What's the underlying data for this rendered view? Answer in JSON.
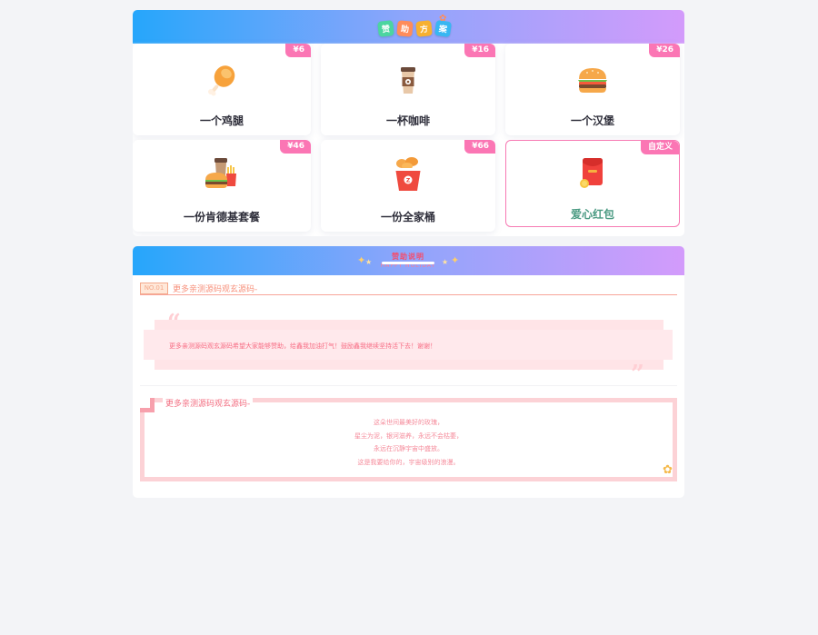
{
  "sponsor_header": {
    "tiles": [
      "赞",
      "助",
      "方",
      "案"
    ]
  },
  "options": [
    {
      "label": "一个鸡腿",
      "price": "¥6",
      "icon": "chicken-leg-icon"
    },
    {
      "label": "一杯咖啡",
      "price": "¥16",
      "icon": "coffee-cup-icon"
    },
    {
      "label": "一个汉堡",
      "price": "¥26",
      "icon": "burger-icon"
    },
    {
      "label": "一份肯德基套餐",
      "price": "¥46",
      "icon": "kfc-meal-icon"
    },
    {
      "label": "一份全家桶",
      "price": "¥66",
      "icon": "chicken-bucket-icon"
    },
    {
      "label": "爱心红包",
      "price": "自定义",
      "icon": "red-envelope-icon"
    }
  ],
  "description": {
    "title": "赞助说明",
    "subtitle": "HAPPY HOLIDAY",
    "no_badge": "NO.01",
    "no_text": "更多亲测源码观玄源码-",
    "quote": "更多亲测源码观玄源码希望大家能够赞助，给鑫我加油打气！鼓励鑫我继续坚持活下去！谢谢！",
    "poem_title": "更多亲测源码观玄源码-",
    "poem": [
      "这朵世间最美好的玫瑰，",
      "星尘为泥，银河滋养，永远不会枯萎，",
      "永远在沉静宇宙中盛放。",
      "这是我要给你的，宇宙级别的浪漫。"
    ]
  },
  "colors": {
    "accent_pink": "#fb76b4",
    "header_gradient": [
      "#26a6fb",
      "#8fa5fb",
      "#d39bfb"
    ],
    "label_green": "#4a9a82"
  }
}
